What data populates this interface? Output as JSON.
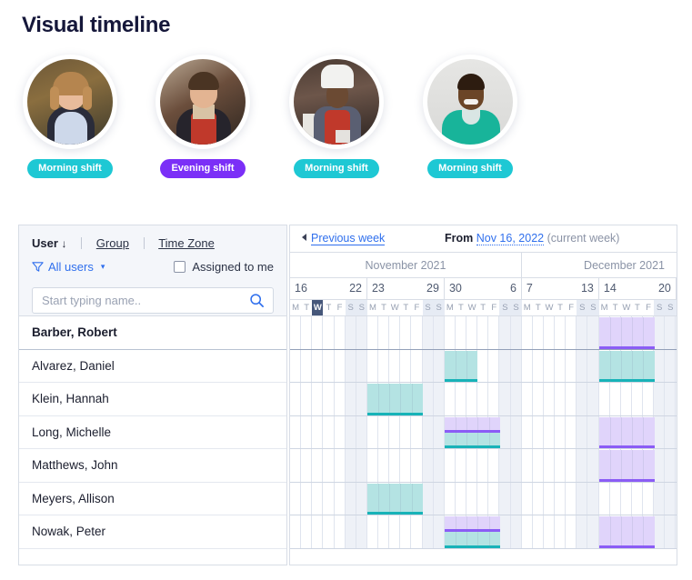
{
  "page": {
    "title": "Visual timeline"
  },
  "staff": [
    {
      "name_badge": "Morning shift",
      "badge_color": "#1ec8d4",
      "avatar": "woman-apron-photo"
    },
    {
      "name_badge": "Evening shift",
      "badge_color": "#7b2ff7",
      "avatar": "man-apron-photo"
    },
    {
      "name_badge": "Morning shift",
      "badge_color": "#1ec8d4",
      "avatar": "chef-hat-photo"
    },
    {
      "name_badge": "Morning shift",
      "badge_color": "#1ec8d4",
      "avatar": "man-teal-shirt-photo"
    }
  ],
  "left_panel": {
    "tabs": [
      {
        "label": "User",
        "selected": true,
        "sort": "↓"
      },
      {
        "label": "Group",
        "selected": false
      },
      {
        "label": "Time Zone",
        "selected": false
      }
    ],
    "filter_label": "All users",
    "assigned_to_me_label": "Assigned to me",
    "assigned_to_me_checked": false,
    "search_placeholder": "Start typing name..",
    "search_value": "",
    "users": [
      "Barber, Robert",
      "Alvarez, Daniel",
      "Klein, Hannah",
      "Long, Michelle",
      "Matthews, John",
      "Meyers, Allison",
      "Nowak, Peter"
    ]
  },
  "timeline": {
    "prev_week_label": "Previous week",
    "from_label": "From",
    "from_date": "Nov 16, 2022",
    "current_week_note": "(current week)",
    "months": [
      {
        "label": "November 2021",
        "weeks": 3
      },
      {
        "label": "December 2021",
        "weeks": 2
      }
    ],
    "weeks": [
      {
        "start": "16",
        "end": "22"
      },
      {
        "start": "23",
        "end": "29"
      },
      {
        "start": "30",
        "end": "6"
      },
      {
        "start": "7",
        "end": "13"
      },
      {
        "start": "14",
        "end": "20"
      }
    ],
    "day_letters": [
      "M",
      "T",
      "W",
      "T",
      "F",
      "S",
      "S"
    ],
    "weekend_indexes": [
      5,
      6
    ],
    "today": {
      "week": 0,
      "day": 2
    },
    "colors": {
      "morning_fill": "#b4e3e3",
      "morning_line": "#17b3b8",
      "evening_fill": "#e0d4fb",
      "evening_line": "#8b5cf6",
      "workday": "#ffffff",
      "offday": "#eef1f7"
    },
    "rows": [
      {
        "user": "Barber, Robert",
        "segments": [
          {
            "week": 4,
            "type": "evening",
            "span": "full"
          }
        ]
      },
      {
        "user": "Alvarez, Daniel",
        "segments": [
          {
            "week": 2,
            "type": "morning",
            "span": "half-left"
          },
          {
            "week": 4,
            "type": "morning",
            "span": "full"
          }
        ]
      },
      {
        "user": "Klein, Hannah",
        "segments": [
          {
            "week": 1,
            "type": "morning",
            "span": "full"
          }
        ]
      },
      {
        "user": "Long, Michelle",
        "segments": [
          {
            "week": 2,
            "type": "evening",
            "span": "full"
          },
          {
            "week": 2,
            "type": "morning",
            "span": "full"
          },
          {
            "week": 4,
            "type": "evening",
            "span": "full"
          }
        ]
      },
      {
        "user": "Matthews, John",
        "segments": [
          {
            "week": 4,
            "type": "evening",
            "span": "full"
          }
        ]
      },
      {
        "user": "Meyers, Allison",
        "segments": [
          {
            "week": 1,
            "type": "morning",
            "span": "full"
          }
        ]
      },
      {
        "user": "Nowak, Peter",
        "segments": [
          {
            "week": 2,
            "type": "evening",
            "span": "full"
          },
          {
            "week": 2,
            "type": "morning",
            "span": "full"
          },
          {
            "week": 4,
            "type": "evening",
            "span": "full"
          }
        ]
      }
    ]
  }
}
